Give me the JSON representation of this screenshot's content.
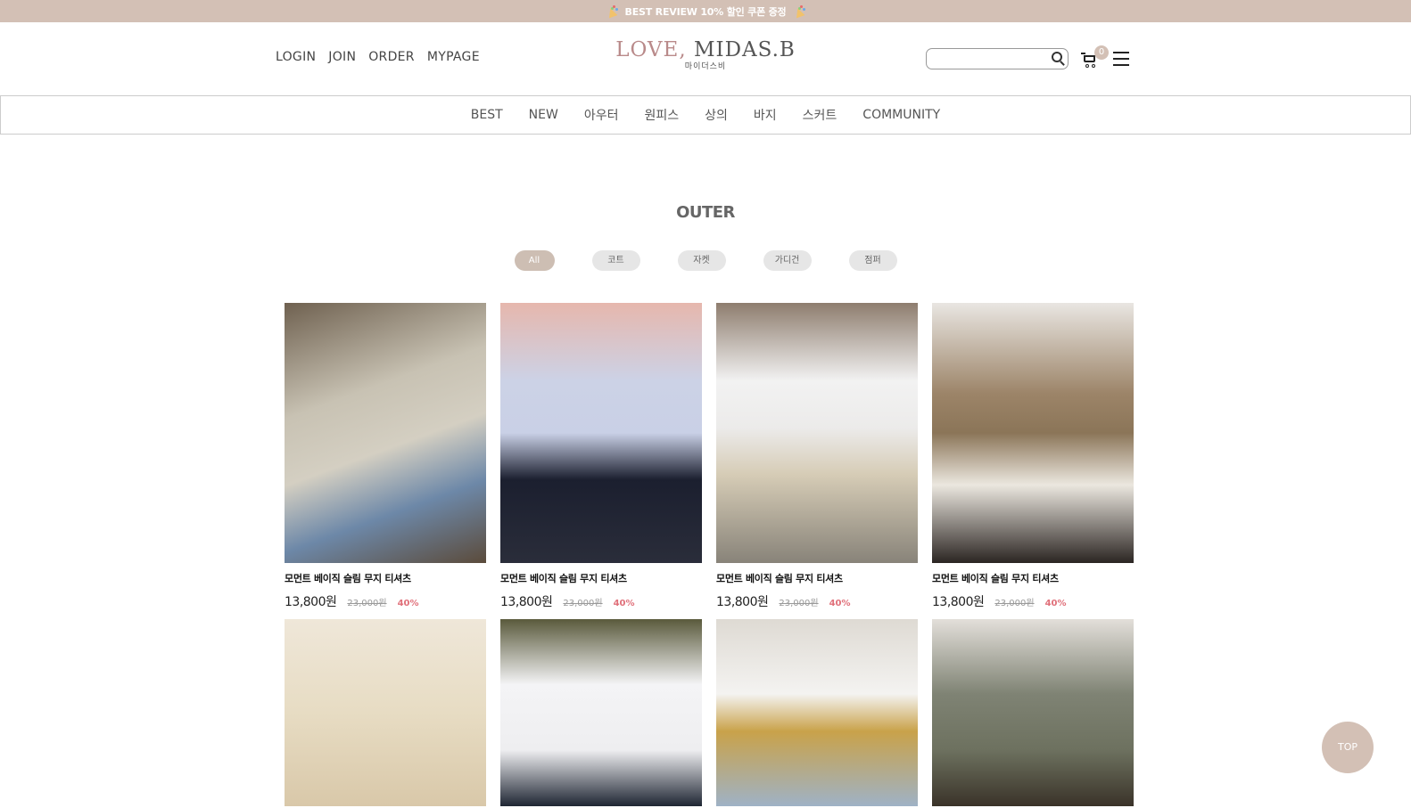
{
  "topbar": {
    "text": "BEST REVIEW 10% 할인 쿠폰 증정",
    "icon": "party-popper-icon"
  },
  "header": {
    "util_links": [
      "LOGIN",
      "JOIN",
      "ORDER",
      "MYPAGE"
    ],
    "logo_main_love": "LOVE,",
    "logo_main_brand": " MIDAS.B",
    "logo_sub": "마이더스비",
    "search_placeholder": "",
    "cart_count": "0"
  },
  "nav": [
    "BEST",
    "NEW",
    "아우터",
    "원피스",
    "상의",
    "바지",
    "스커트",
    "COMMUNITY"
  ],
  "category": {
    "title": "OUTER",
    "filters": [
      "All",
      "코트",
      "자켓",
      "가디건",
      "점퍼"
    ],
    "active_filter": "All"
  },
  "products": [
    {
      "name": "모먼트 베이직 슬림 무지 티셔츠",
      "price": "13,800원",
      "original": "23,000원",
      "discount": "40%"
    },
    {
      "name": "모먼트 베이직 슬림 무지 티셔츠",
      "price": "13,800원",
      "original": "23,000원",
      "discount": "40%"
    },
    {
      "name": "모먼트 베이직 슬림 무지 티셔츠",
      "price": "13,800원",
      "original": "23,000원",
      "discount": "40%"
    },
    {
      "name": "모먼트 베이직 슬림 무지 티셔츠",
      "price": "13,800원",
      "original": "23,000원",
      "discount": "40%"
    }
  ],
  "top_button": "TOP",
  "colors": {
    "accent": "#d3c0b5",
    "sale": "#e0707a"
  }
}
